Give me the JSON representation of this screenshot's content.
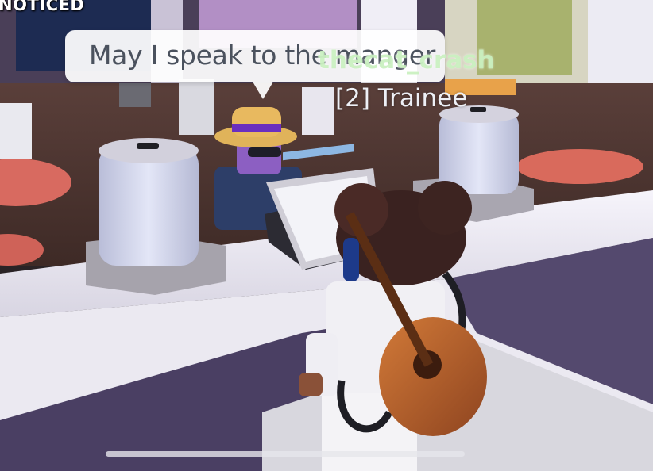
{
  "overlay": {
    "top_text": "NOTICED"
  },
  "chat": {
    "message": "May I speak to the manger"
  },
  "player": {
    "username": "thecat_crash",
    "rank": "[2] Trainee"
  }
}
